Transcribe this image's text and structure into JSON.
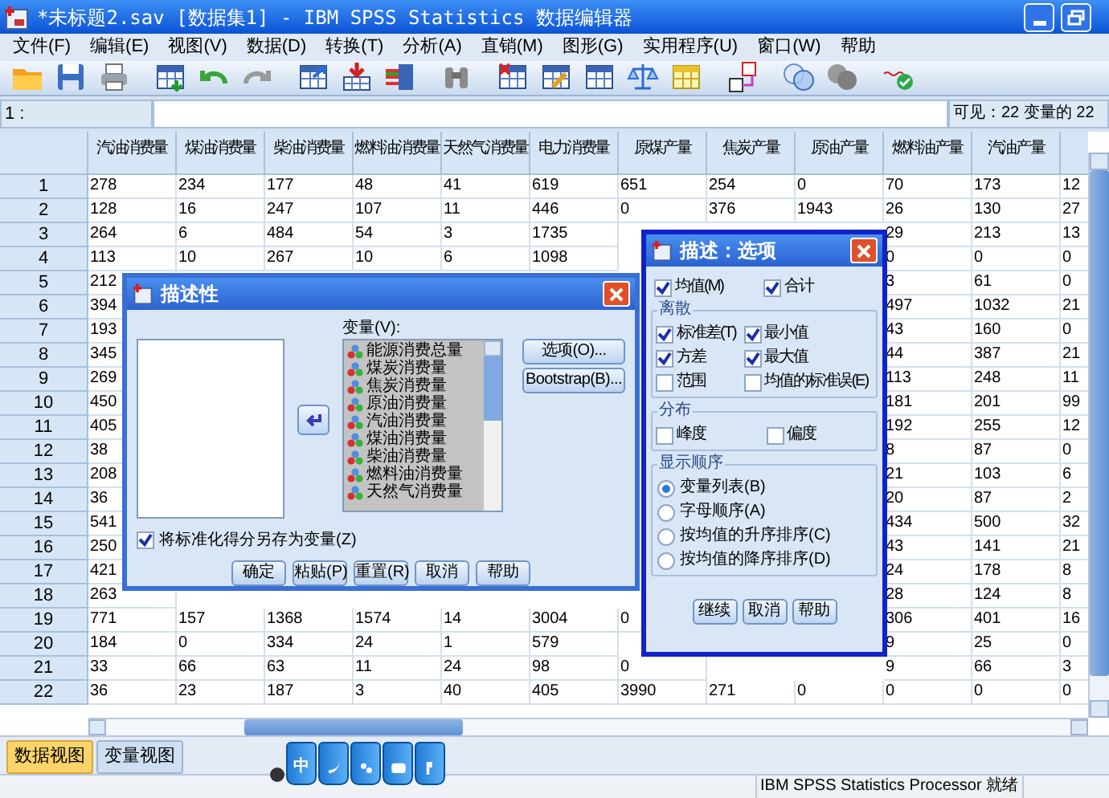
{
  "window": {
    "title": "*未标题2.sav [数据集1] - IBM SPSS Statistics 数据编辑器"
  },
  "menu": [
    "文件(F)",
    "编辑(E)",
    "视图(V)",
    "数据(D)",
    "转换(T)",
    "分析(A)",
    "直销(M)",
    "图形(G)",
    "实用程序(U)",
    "窗口(W)",
    "帮助"
  ],
  "cell_editor": {
    "cell_ref": "1 :",
    "visible_info": "可见：22 变量的 22"
  },
  "table": {
    "columns": [
      "汽油消费量",
      "煤油消费量",
      "柴油消费量",
      "燃料油消费量",
      "天然气消费量",
      "电力消费量",
      "原煤产量",
      "焦炭产量",
      "原油产量",
      "燃料油产量",
      "汽油产量"
    ],
    "rows": [
      {
        "header": "1",
        "cells": [
          "278",
          "234",
          "177",
          "48",
          "41",
          "619",
          "651",
          "254",
          "0",
          "70",
          "173",
          "12"
        ]
      },
      {
        "header": "2",
        "cells": [
          "128",
          "16",
          "247",
          "107",
          "11",
          "446",
          "0",
          "376",
          "1943",
          "26",
          "130",
          "27"
        ]
      },
      {
        "header": "3",
        "cells": [
          "264",
          "6",
          "484",
          "54",
          "3",
          "1735",
          null,
          null,
          null,
          "29",
          "213",
          "13"
        ]
      },
      {
        "header": "4",
        "cells": [
          "113",
          "10",
          "267",
          "10",
          "6",
          "1098",
          null,
          null,
          null,
          "0",
          "0",
          "0"
        ]
      },
      {
        "header": "5",
        "cells": [
          "212",
          null,
          null,
          null,
          null,
          null,
          null,
          null,
          null,
          "3",
          "61",
          "0"
        ]
      },
      {
        "header": "6",
        "cells": [
          "394",
          null,
          null,
          null,
          null,
          null,
          null,
          null,
          null,
          "497",
          "1032",
          "21"
        ]
      },
      {
        "header": "7",
        "cells": [
          "193",
          null,
          null,
          null,
          null,
          null,
          null,
          null,
          null,
          "43",
          "160",
          "0"
        ]
      },
      {
        "header": "8",
        "cells": [
          "345",
          null,
          null,
          null,
          null,
          null,
          null,
          null,
          null,
          "44",
          "387",
          "21"
        ]
      },
      {
        "header": "9",
        "cells": [
          "269",
          null,
          null,
          null,
          null,
          null,
          null,
          null,
          null,
          "113",
          "248",
          "11"
        ]
      },
      {
        "header": "10",
        "cells": [
          "450",
          null,
          null,
          null,
          null,
          null,
          null,
          null,
          null,
          "181",
          "201",
          "99"
        ]
      },
      {
        "header": "11",
        "cells": [
          "405",
          null,
          null,
          null,
          null,
          null,
          null,
          null,
          null,
          "192",
          "255",
          "12"
        ]
      },
      {
        "header": "12",
        "cells": [
          "38",
          null,
          null,
          null,
          null,
          null,
          null,
          null,
          null,
          "8",
          "87",
          "0"
        ]
      },
      {
        "header": "13",
        "cells": [
          "208",
          null,
          null,
          null,
          null,
          null,
          null,
          null,
          null,
          "21",
          "103",
          "6"
        ]
      },
      {
        "header": "14",
        "cells": [
          "36",
          null,
          null,
          null,
          null,
          null,
          null,
          null,
          null,
          "20",
          "87",
          "2"
        ]
      },
      {
        "header": "15",
        "cells": [
          "541",
          null,
          null,
          null,
          null,
          null,
          null,
          null,
          null,
          "434",
          "500",
          "32"
        ]
      },
      {
        "header": "16",
        "cells": [
          "250",
          null,
          null,
          null,
          null,
          null,
          null,
          null,
          null,
          "43",
          "141",
          "21"
        ]
      },
      {
        "header": "17",
        "cells": [
          "421",
          null,
          null,
          null,
          null,
          null,
          null,
          null,
          null,
          "24",
          "178",
          "8"
        ]
      },
      {
        "header": "18",
        "cells": [
          "263",
          null,
          null,
          null,
          null,
          null,
          null,
          null,
          null,
          "28",
          "124",
          "8"
        ]
      },
      {
        "header": "19",
        "cells": [
          "771",
          "157",
          "1368",
          "1574",
          "14",
          "3004",
          "0",
          null,
          null,
          "306",
          "401",
          "16"
        ]
      },
      {
        "header": "20",
        "cells": [
          "184",
          "0",
          "334",
          "24",
          "1",
          "579",
          null,
          null,
          null,
          "9",
          "25",
          "0"
        ]
      },
      {
        "header": "21",
        "cells": [
          "33",
          "66",
          "63",
          "11",
          "24",
          "98",
          "0",
          null,
          null,
          "9",
          "66",
          "3"
        ]
      },
      {
        "header": "22",
        "cells": [
          "36",
          "23",
          "187",
          "3",
          "40",
          "405",
          "3990",
          "271",
          "0",
          "0",
          "0",
          "0"
        ]
      }
    ]
  },
  "tabs": [
    {
      "label": "数据视图",
      "selected": true
    },
    {
      "label": "变量视图",
      "selected": false
    }
  ],
  "ime_toolbar": {
    "label": "中"
  },
  "status_bar": {
    "text": "IBM SPSS Statistics Processor 就绪"
  },
  "descriptives_dialog": {
    "title": "描述性",
    "variables_label": "变量(V):",
    "variables": [
      "能源消费总量",
      "煤炭消费量",
      "焦炭消费量",
      "原油消费量",
      "汽油消费量",
      "煤油消费量",
      "柴油消费量",
      "燃料油消费量",
      "天然气消费量"
    ],
    "side_buttons": [
      "选项(O)...",
      "Bootstrap(B)..."
    ],
    "save_standardized": {
      "label": "将标准化得分另存为变量(Z)",
      "checked": true
    },
    "buttons": [
      "确定",
      "粘贴(P)",
      "重置(R)",
      "取消",
      "帮助"
    ]
  },
  "options_dialog": {
    "title": "描述：选项",
    "top": [
      {
        "label": "均值(M)",
        "checked": true
      },
      {
        "label": "合计",
        "checked": true
      }
    ],
    "dispersion": {
      "title": "离散",
      "items": [
        {
          "label": "标准差(T)",
          "checked": true
        },
        {
          "label": "最小值",
          "checked": true
        },
        {
          "label": "方差",
          "checked": true
        },
        {
          "label": "最大值",
          "checked": true
        },
        {
          "label": "范围",
          "checked": false
        },
        {
          "label": "均值的标准误(E)",
          "checked": false
        }
      ]
    },
    "distribution": {
      "title": "分布",
      "items": [
        {
          "label": "峰度",
          "checked": false
        },
        {
          "label": "偏度",
          "checked": false
        }
      ]
    },
    "display_order": {
      "title": "显示顺序",
      "items": [
        {
          "label": "变量列表(B)",
          "selected": true
        },
        {
          "label": "字母顺序(A)",
          "selected": false
        },
        {
          "label": "按均值的升序排序(C)",
          "selected": false
        },
        {
          "label": "按均值的降序排序(D)",
          "selected": false
        }
      ]
    },
    "buttons": [
      "继续",
      "取消",
      "帮助"
    ]
  }
}
